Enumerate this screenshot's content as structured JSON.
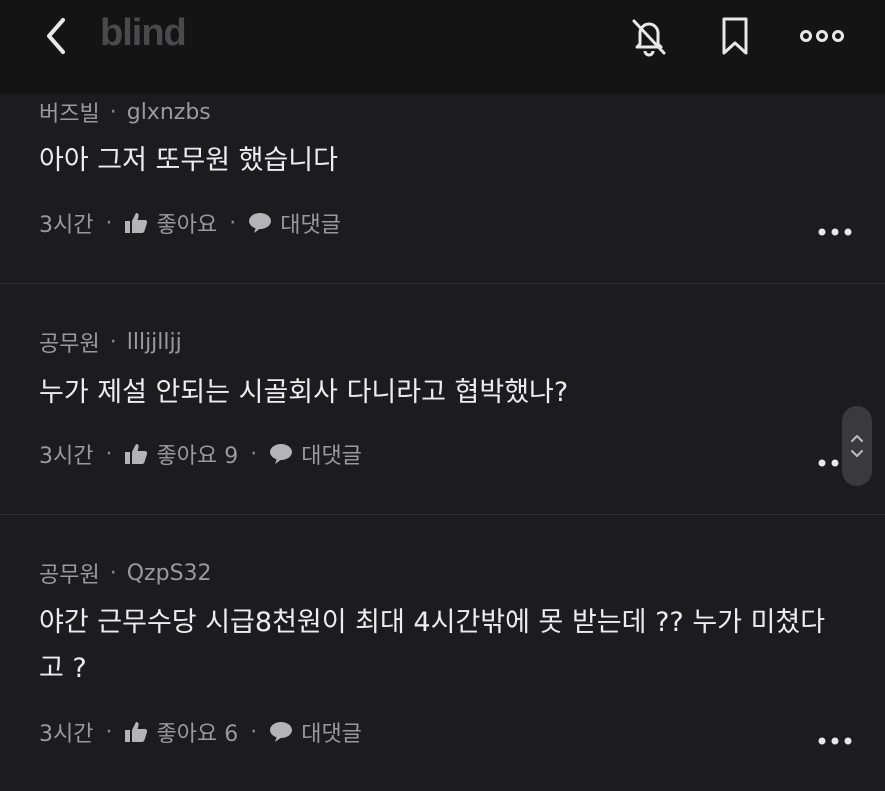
{
  "header": {
    "logo": "blind",
    "icons": [
      "back-chevron-icon",
      "bell-off-icon",
      "bookmark-icon",
      "more-horizontal-icon"
    ]
  },
  "comments": [
    {
      "company": "버즈빌",
      "separator": "·",
      "author": "glxnzbs",
      "text": "아아 그저 또무원 했습니다",
      "time": "3시간",
      "like_label": "좋아요",
      "reply_label": "대댓글"
    },
    {
      "company": "공무원",
      "separator": "·",
      "author": "llljjlljj",
      "text": "누가 제설 안되는 시골회사 다니라고 협박했나?",
      "time": "3시간",
      "like_label": "좋아요 9",
      "reply_label": "대댓글"
    },
    {
      "company": "공무원",
      "separator": "·",
      "author": "QzpS32",
      "text": "야간 근무수당 시급8천원이 최대 4시간밖에 못 받는데 ?? 누가 미쳤다고 ?",
      "time": "3시간",
      "like_label": "좋아요 6",
      "reply_label": "대댓글"
    }
  ],
  "action_separator": "·",
  "colors": {
    "background": "#1c1c1e",
    "header": "#141414",
    "text": "#ededed",
    "muted": "#9a9a9e",
    "logo": "#4a4a4c"
  }
}
